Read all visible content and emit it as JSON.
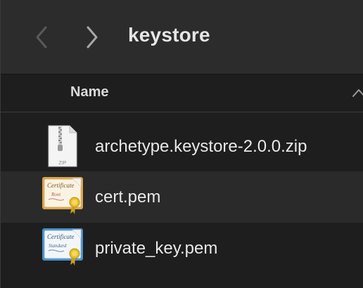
{
  "toolbar": {
    "back_icon": "chevron-left-icon",
    "forward_icon": "chevron-right-icon",
    "title": "keystore"
  },
  "list_header": {
    "name_column": "Name",
    "sort_icon": "chevron-up-icon"
  },
  "files": [
    {
      "name": "archetype.keystore-2.0.0.zip",
      "icon": "zip-file-icon",
      "icon_label": "ZIP"
    },
    {
      "name": "cert.pem",
      "icon": "certificate-file-icon",
      "icon_label": "Certificate",
      "icon_sublabel": "Root"
    },
    {
      "name": "private_key.pem",
      "icon": "certificate-file-icon",
      "icon_label": "Certificate",
      "icon_sublabel": "Standard"
    }
  ],
  "colors": {
    "background": "#1e1e1e",
    "toolbar": "#2c2c2c",
    "alt_row": "#2a2a2a",
    "text": "#e8e8e8"
  }
}
